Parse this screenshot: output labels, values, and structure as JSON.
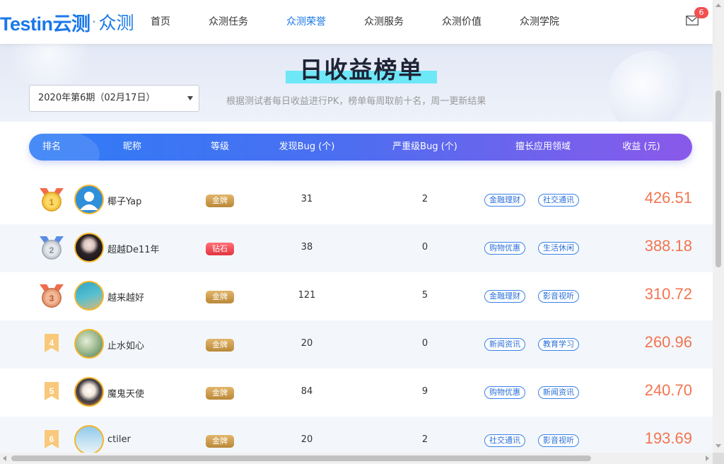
{
  "header": {
    "logo_brand": "Testin云测",
    "logo_sep": "·",
    "logo_crowd": "众测",
    "nav": [
      "首页",
      "众测任务",
      "众测荣誉",
      "众测服务",
      "众测价值",
      "众测学院"
    ],
    "active_nav_index": 2,
    "mail_count": "6"
  },
  "banner": {
    "title": "日收益榜单",
    "period_select": "2020年第6期（02月17日）",
    "hint": "根据测试者每日收益进行PK，榜单每周取前十名，周一更新结果"
  },
  "table": {
    "columns": {
      "rank": "排名",
      "nickname": "昵称",
      "level": "等级",
      "bugs": "发现Bug (个)",
      "severe": "严重级Bug (个)",
      "domains": "擅长应用领域",
      "income": "收益 (元)"
    },
    "rows": [
      {
        "rank": "1",
        "nickname": "椰子Yap",
        "level": "金牌",
        "level_type": "gold",
        "bugs": "31",
        "severe": "2",
        "tags": [
          "金融理财",
          "社交通讯"
        ],
        "income": "426.51",
        "avatar": "default-user"
      },
      {
        "rank": "2",
        "nickname": "超越De11年",
        "level": "钻石",
        "level_type": "diamond",
        "bugs": "38",
        "severe": "0",
        "tags": [
          "购物优惠",
          "生活休闲"
        ],
        "income": "388.18",
        "avatar": "portrait-dark"
      },
      {
        "rank": "3",
        "nickname": "越来越好",
        "level": "金牌",
        "level_type": "gold",
        "bugs": "121",
        "severe": "5",
        "tags": [
          "金融理财",
          "影音视听"
        ],
        "income": "310.72",
        "avatar": "teal-scene"
      },
      {
        "rank": "4",
        "nickname": "止水如心",
        "level": "金牌",
        "level_type": "gold",
        "bugs": "20",
        "severe": "0",
        "tags": [
          "新闻资讯",
          "教育学习"
        ],
        "income": "260.96",
        "avatar": "green-leaf"
      },
      {
        "rank": "5",
        "nickname": "魔鬼天使",
        "level": "金牌",
        "level_type": "gold",
        "bugs": "84",
        "severe": "9",
        "tags": [
          "购物优惠",
          "新闻资讯"
        ],
        "income": "240.70",
        "avatar": "cartoon"
      },
      {
        "rank": "6",
        "nickname": "ctiler",
        "level": "金牌",
        "level_type": "gold",
        "bugs": "20",
        "severe": "2",
        "tags": [
          "社交通讯",
          "影音视听"
        ],
        "income": "193.69",
        "avatar": "sky-figure"
      }
    ]
  },
  "colors": {
    "brand": "#1a78ea",
    "income": "#f3744f",
    "gold_level": "#c9a052",
    "diamond_level": "#e8424c",
    "tag_border": "#3a82e8"
  }
}
